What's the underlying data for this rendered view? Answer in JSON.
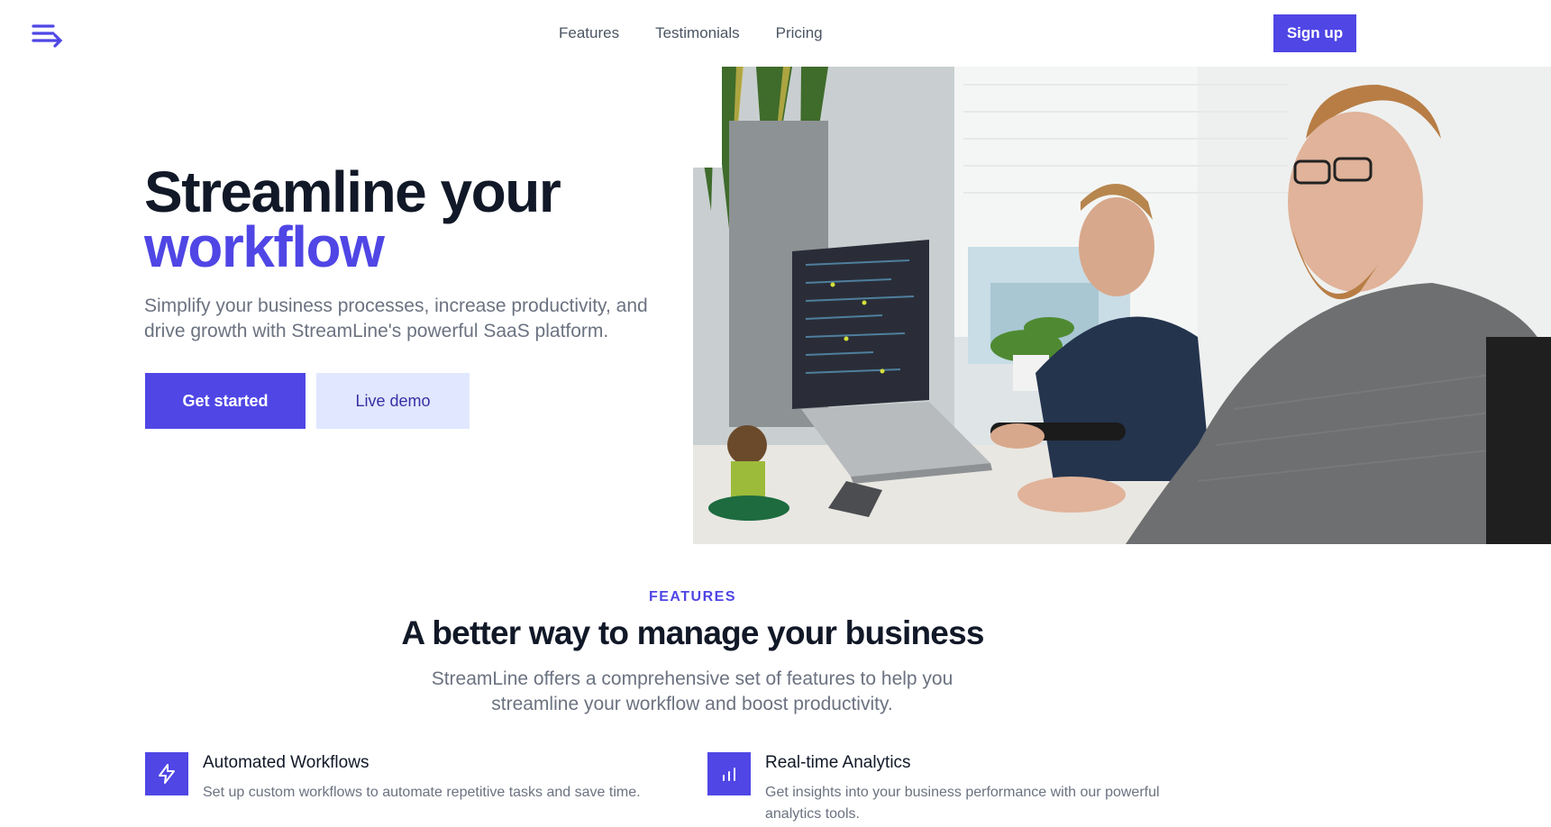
{
  "nav": {
    "logo_icon": "streamline-logo-icon",
    "links": [
      "Features",
      "Testimonials",
      "Pricing"
    ],
    "signup_label": "Sign up"
  },
  "hero": {
    "title_line1": "Streamline your",
    "title_line2": "workflow",
    "subtitle": "Simplify your business processes, increase productivity, and drive growth with StreamLine's powerful SaaS platform.",
    "primary_cta": "Get started",
    "secondary_cta": "Live demo",
    "image_icon": "office-workers-photo"
  },
  "features": {
    "eyebrow": "FEATURES",
    "title": "A better way to manage your business",
    "subtitle": "StreamLine offers a comprehensive set of features to help you streamline your workflow and boost productivity.",
    "items": [
      {
        "title": "Automated Workflows",
        "description": "Set up custom workflows to automate repetitive tasks and save time.",
        "icon": "lightning-bolt-icon"
      },
      {
        "title": "Real-time Analytics",
        "description": "Get insights into your business performance with our powerful analytics tools.",
        "icon": "bar-chart-icon"
      }
    ]
  },
  "colors": {
    "brand": "#4f46e5",
    "brand_light": "#e0e7ff",
    "heading": "#111827",
    "body": "#6b7280"
  }
}
